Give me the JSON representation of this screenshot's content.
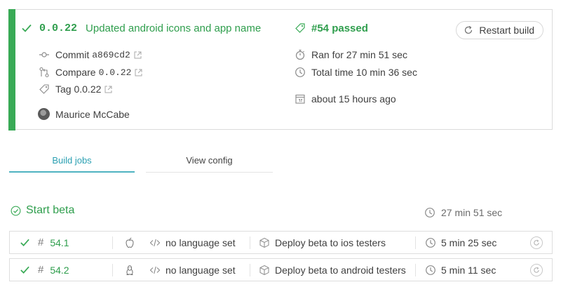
{
  "build": {
    "branch": "0.0.22",
    "message": "Updated android icons and app name",
    "number_status": "#54 passed",
    "restart_label": "Restart build",
    "commit_label": "Commit",
    "commit_sha": "a869cd2",
    "compare_label": "Compare",
    "compare_ref": "0.0.22",
    "tag_label": "Tag 0.0.22",
    "author": "Maurice McCabe",
    "ran_for": "Ran for 27 min 51 sec",
    "total_time": "Total time 10 min 36 sec",
    "finished": "about 15 hours ago"
  },
  "tabs": [
    {
      "label": "Build jobs",
      "active": true
    },
    {
      "label": "View config",
      "active": false
    }
  ],
  "stage": {
    "title": "Start beta",
    "duration": "27 min 51 sec"
  },
  "jobs": [
    {
      "number": "54.1",
      "os_icon": "apple-icon",
      "language": "no language set",
      "name": "Deploy beta to ios testers",
      "duration": "5 min 25 sec"
    },
    {
      "number": "54.2",
      "os_icon": "linux-icon",
      "language": "no language set",
      "name": "Deploy beta to android testers",
      "duration": "5 min 11 sec"
    }
  ],
  "colors": {
    "passed": "#39aa56",
    "passed_text": "#2f9e4d",
    "tab_active": "#2ba0b2",
    "border": "#dcdcdc"
  }
}
